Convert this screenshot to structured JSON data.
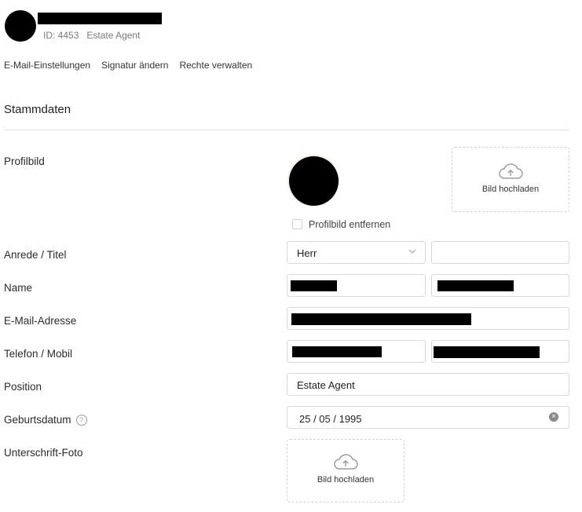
{
  "profile": {
    "id_text": "ID: 4453",
    "role": "Estate Agent"
  },
  "links": [
    "E-Mail-Einstellungen",
    "Signatur ändern",
    "Rechte verwalten"
  ],
  "section": {
    "title": "Stammdaten"
  },
  "labels": {
    "profilbild": "Profilbild",
    "anrede": "Anrede / Titel",
    "name": "Name",
    "email": "E-Mail-Adresse",
    "telefon": "Telefon / Mobil",
    "position": "Position",
    "geburtsdatum": "Geburtsdatum",
    "unterschrift": "Unterschrift-Foto"
  },
  "upload": {
    "label": "Bild hochladen"
  },
  "checkbox": {
    "remove_label": "Profilbild entfernen"
  },
  "fields": {
    "anrede_value": "Herr",
    "position_value": "Estate Agent",
    "geburtsdatum_value": "25 / 05 / 1995"
  },
  "icons": {
    "upload": "cloud-upload-icon",
    "select": "chevron-down-icon",
    "clear": "clear-icon",
    "help": "help-icon"
  }
}
